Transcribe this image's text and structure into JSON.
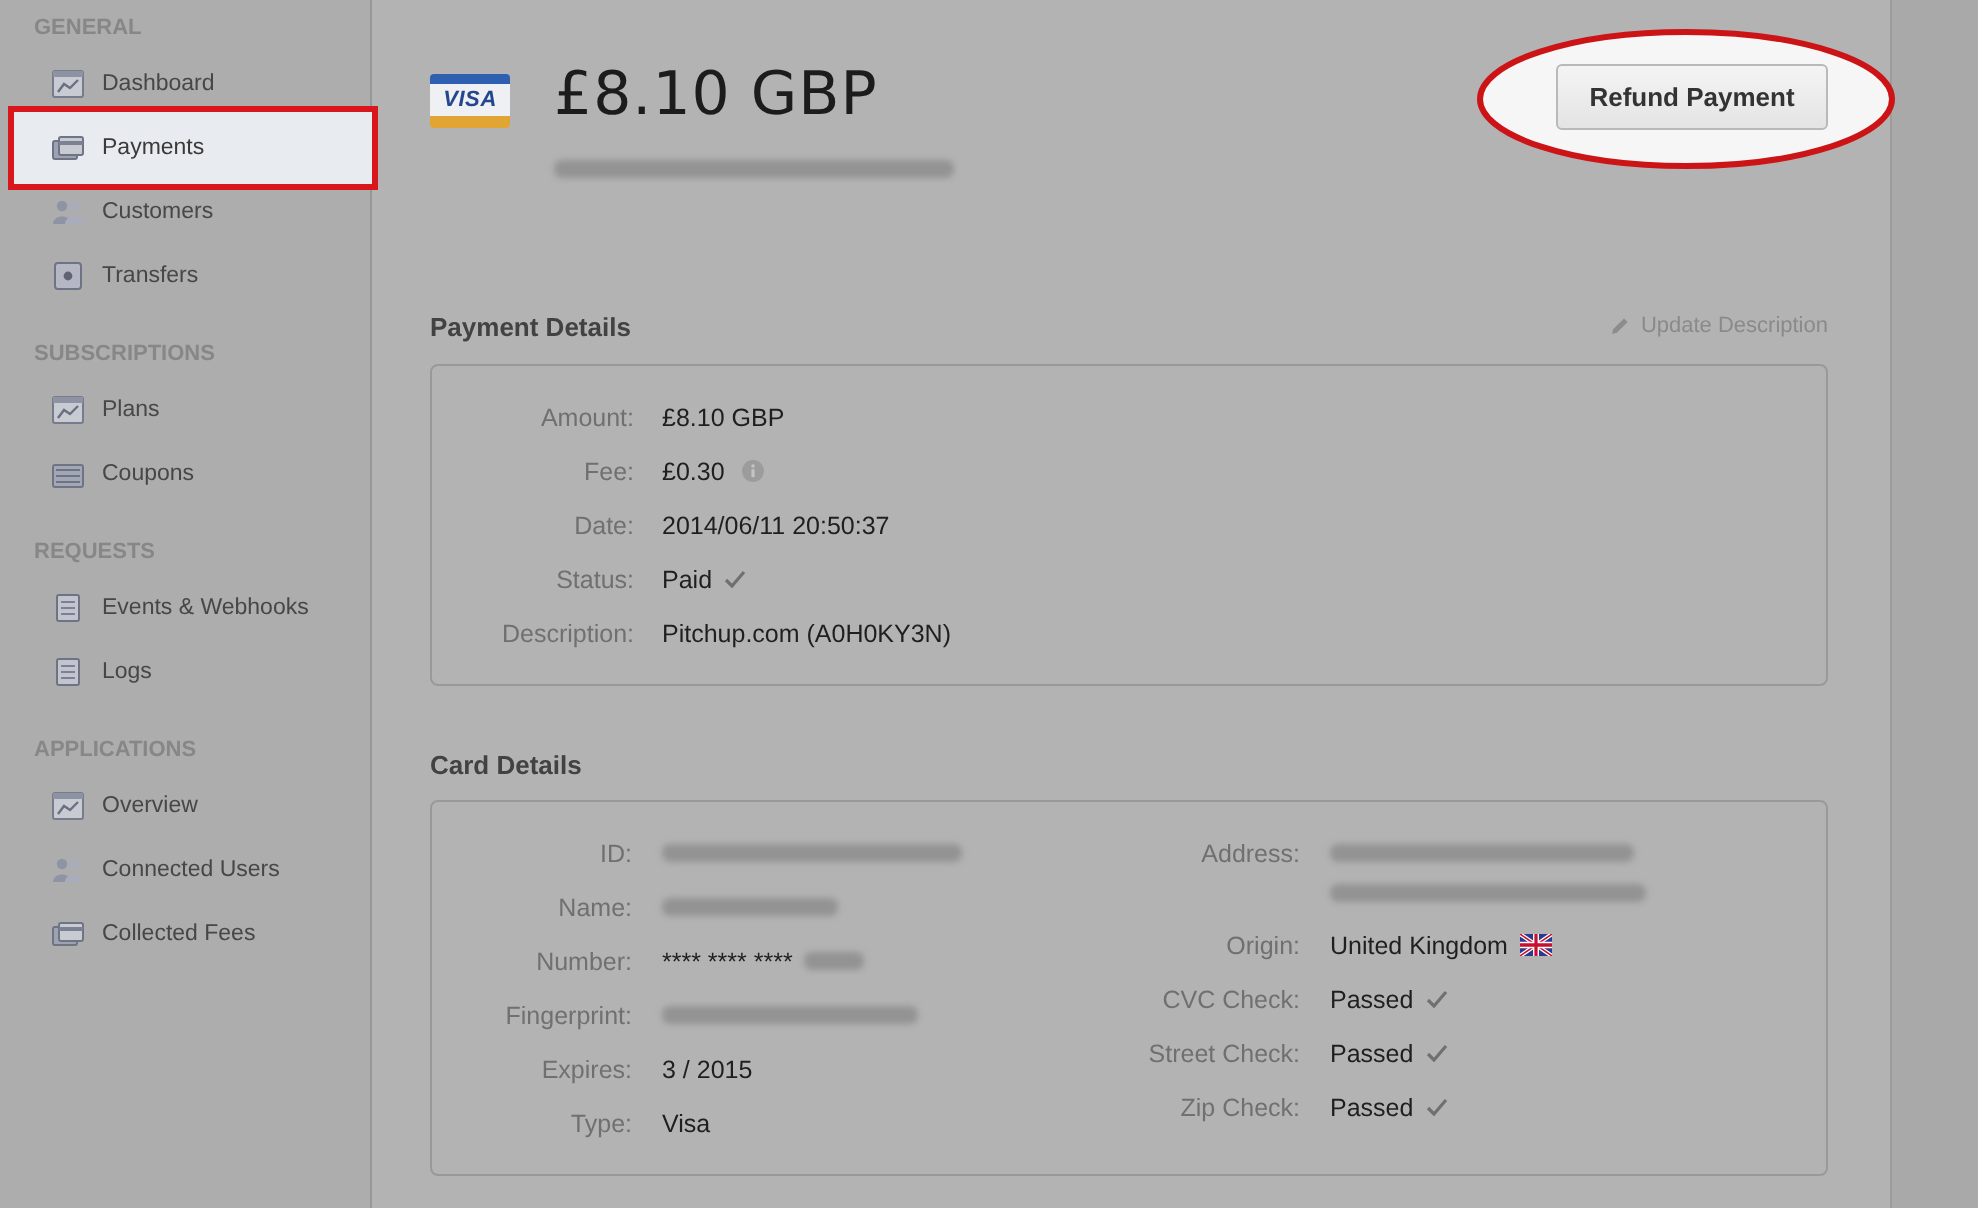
{
  "sidebar": {
    "sections": [
      {
        "title": "GENERAL",
        "items": [
          {
            "label": "Dashboard",
            "selected": false
          },
          {
            "label": "Payments",
            "selected": true
          },
          {
            "label": "Customers",
            "selected": false
          },
          {
            "label": "Transfers",
            "selected": false
          }
        ]
      },
      {
        "title": "SUBSCRIPTIONS",
        "items": [
          {
            "label": "Plans",
            "selected": false
          },
          {
            "label": "Coupons",
            "selected": false
          }
        ]
      },
      {
        "title": "REQUESTS",
        "items": [
          {
            "label": "Events & Webhooks",
            "selected": false
          },
          {
            "label": "Logs",
            "selected": false
          }
        ]
      },
      {
        "title": "APPLICATIONS",
        "items": [
          {
            "label": "Overview",
            "selected": false
          },
          {
            "label": "Connected Users",
            "selected": false
          },
          {
            "label": "Collected Fees",
            "selected": false
          }
        ]
      }
    ]
  },
  "header": {
    "card_logo": "VISA",
    "amount": "£8.10 GBP",
    "id_redacted": true,
    "refund_button": {
      "label": "Refund Payment",
      "highlighted": true
    }
  },
  "payment_details": {
    "title": "Payment Details",
    "action": "Update Description",
    "rows": [
      {
        "kind": "text",
        "label": "Amount:",
        "value": "£8.10 GBP"
      },
      {
        "kind": "info",
        "label": "Fee:",
        "value": "£0.30"
      },
      {
        "kind": "text",
        "label": "Date:",
        "value": "2014/06/11 20:50:37"
      },
      {
        "kind": "check",
        "label": "Status:",
        "value": "Paid"
      },
      {
        "kind": "text",
        "label": "Description:",
        "value": "Pitchup.com (A0H0KY3N)"
      }
    ]
  },
  "card_details": {
    "title": "Card Details",
    "columns": [
      [
        {
          "kind": "redacted",
          "label": "ID:"
        },
        {
          "kind": "redacted",
          "label": "Name:"
        },
        {
          "kind": "masked",
          "label": "Number:",
          "value": "**** **** ****"
        },
        {
          "kind": "redacted",
          "label": "Fingerprint:"
        },
        {
          "kind": "text",
          "label": "Expires:",
          "value": "3 / 2015"
        },
        {
          "kind": "text",
          "label": "Type:",
          "value": "Visa"
        }
      ],
      [
        {
          "kind": "redacted_multiline",
          "label": "Address:"
        },
        {
          "kind": "flag",
          "label": "Origin:",
          "value": "United Kingdom"
        },
        {
          "kind": "check",
          "label": "CVC Check:",
          "value": "Passed"
        },
        {
          "kind": "check",
          "label": "Street Check:",
          "value": "Passed"
        },
        {
          "kind": "check",
          "label": "Zip Check:",
          "value": "Passed"
        }
      ]
    ]
  }
}
